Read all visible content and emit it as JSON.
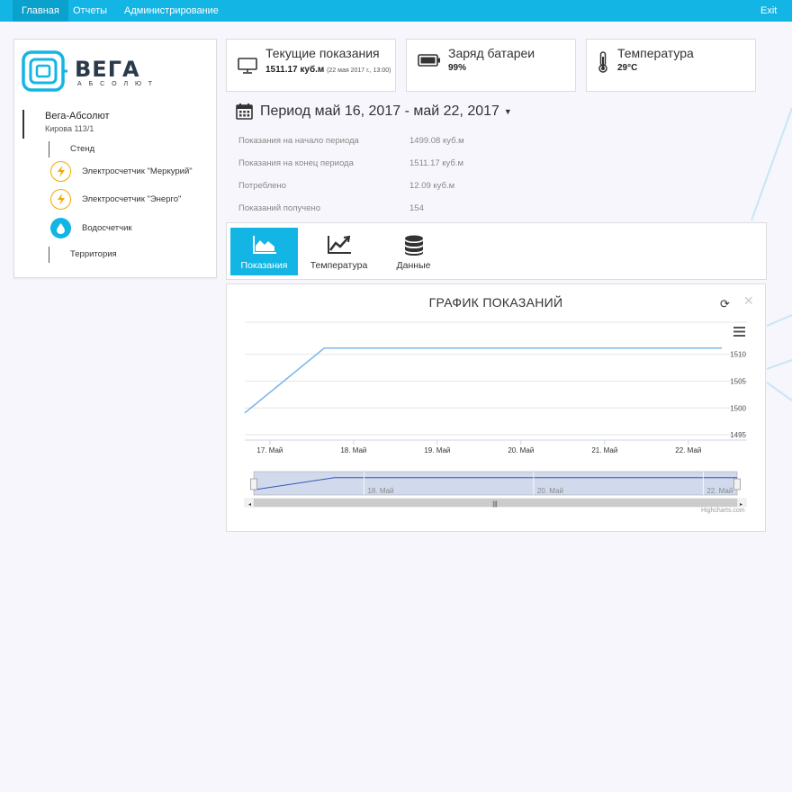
{
  "nav": {
    "items": [
      "Главная",
      "Отчеты",
      "Администрирование"
    ],
    "exit": "Exit"
  },
  "logo": {
    "word": "ВЕГА",
    "sub": "АБСОЛЮТ"
  },
  "device": {
    "name": "Вега-Абсолют",
    "address": "Кирова 113/1",
    "tree": [
      "Стенд",
      "Электросчетчик \"Меркурий\"",
      "Электросчетчик \"Энерго\"",
      "Водосчетчик",
      "Территория"
    ]
  },
  "cards": {
    "current": {
      "title": "Текущие показания",
      "value": "1511.17 куб.м",
      "note": "(22 мая 2017 г., 13:00)"
    },
    "battery": {
      "title": "Заряд батареи",
      "value": "99%"
    },
    "temperature": {
      "title": "Температура",
      "value": "29°C"
    }
  },
  "period": {
    "label": "Период май 16, 2017 - май 22, 2017"
  },
  "stats": [
    {
      "label": "Показания на начало периода",
      "value": "1499.08 куб.м"
    },
    {
      "label": "Показания на конец периода",
      "value": "1511.17 куб.м"
    },
    {
      "label": "Потреблено",
      "value": "12.09 куб.м"
    },
    {
      "label": "Показаний получено",
      "value": "154"
    }
  ],
  "tabs": [
    "Показания",
    "Температура",
    "Данные"
  ],
  "chart": {
    "title": "ГРАФИК ПОКАЗАНИЙ",
    "credits": "Highcharts.com",
    "navigator_labels": [
      "18. Май",
      "20. Май",
      "22. Май"
    ]
  },
  "colors": {
    "accent": "#13b5e4",
    "line": "#7cb5ec",
    "warning": "#f2a900"
  },
  "chart_data": {
    "type": "line",
    "title": "ГРАФИК ПОКАЗАНИЙ",
    "x_ticks": [
      "17. Май",
      "18. Май",
      "19. Май",
      "20. Май",
      "21. Май",
      "22. Май"
    ],
    "y_ticks": [
      1495,
      1500,
      1505,
      1510
    ],
    "ylim": [
      1494,
      1516
    ],
    "series": [
      {
        "x": [
          16.7,
          17.65,
          22.4
        ],
        "y": [
          1499.08,
          1511.17,
          1511.17
        ]
      }
    ],
    "x_range": [
      16.7,
      22.4
    ],
    "grid": true,
    "legend": "none"
  }
}
